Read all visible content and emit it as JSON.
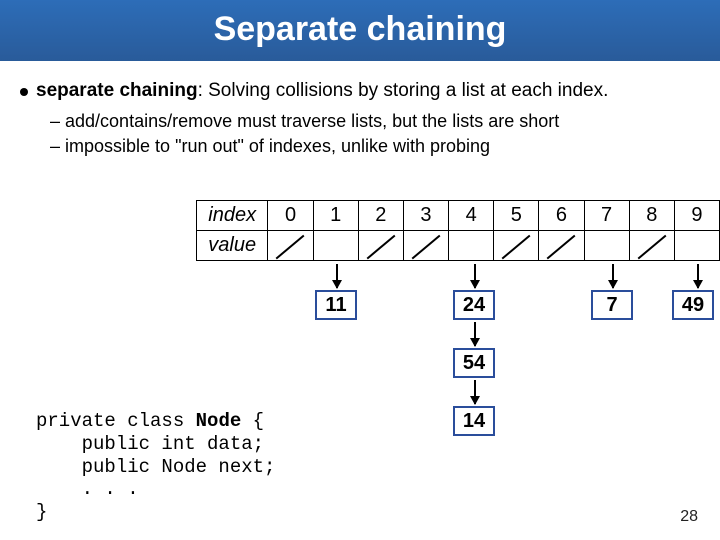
{
  "title": "Separate chaining",
  "bullet": {
    "term": "separate chaining",
    "rest": ": Solving collisions by storing a list at each index."
  },
  "dashes": [
    "add/contains/remove must traverse lists, but the lists are short",
    "impossible to \"run out\" of indexes, unlike with probing"
  ],
  "table": {
    "index_label": "index",
    "value_label": "value",
    "indices": [
      "0",
      "1",
      "2",
      "3",
      "4",
      "5",
      "6",
      "7",
      "8",
      "9"
    ],
    "empty_slots": [
      0,
      2,
      3,
      5,
      6,
      8
    ],
    "chains": {
      "1": [
        11
      ],
      "4": [
        24,
        54,
        14
      ],
      "7": [
        7
      ],
      "9": [
        49
      ]
    }
  },
  "code": {
    "l1a": "private class ",
    "l1b": "Node",
    "l1c": " {",
    "l2": "    public int data;",
    "l3": "    public Node next;",
    "l4": "    . . .",
    "l5": "}"
  },
  "page_number": "28"
}
